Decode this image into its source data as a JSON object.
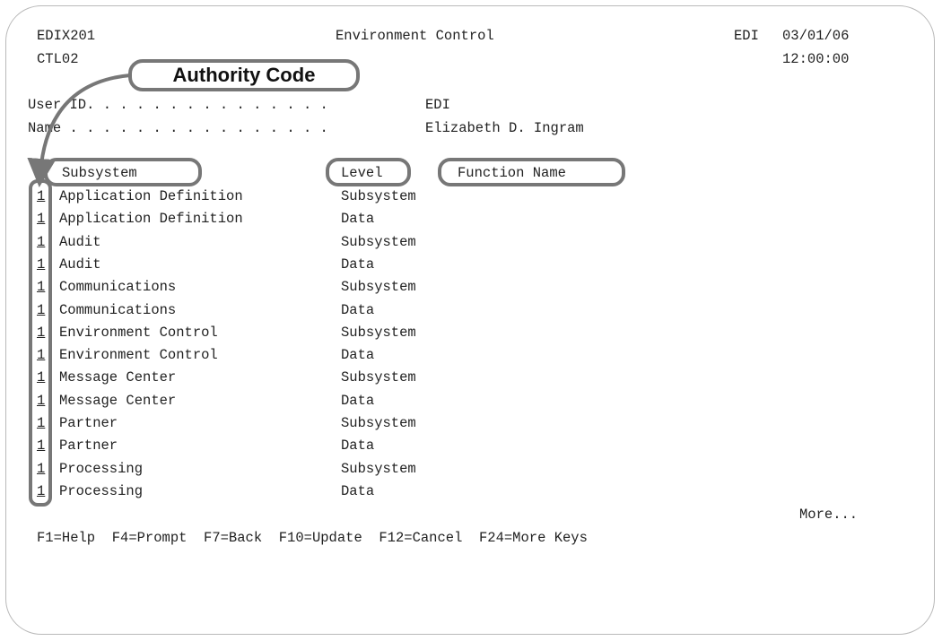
{
  "header": {
    "program_id": "EDIX201",
    "screen_id": "CTL02",
    "title": "Environment Control",
    "system": "EDI",
    "date": "03/01/06",
    "time": "12:00:00"
  },
  "fields": {
    "user_id_label": "User ID. . . . . . . . . . . . . . .",
    "user_id_value": "EDI",
    "name_label": "Name . . . . . . . . . . . . . . . .",
    "name_value": "Elizabeth D. Ingram"
  },
  "columns": {
    "subsystem": "Subsystem",
    "level": "Level",
    "function_name": "Function Name"
  },
  "rows": [
    {
      "code": "1",
      "subsystem": "Application Definition",
      "level": "Subsystem"
    },
    {
      "code": "1",
      "subsystem": "Application Definition",
      "level": "Data"
    },
    {
      "code": "1",
      "subsystem": "Audit",
      "level": "Subsystem"
    },
    {
      "code": "1",
      "subsystem": "Audit",
      "level": "Data"
    },
    {
      "code": "1",
      "subsystem": "Communications",
      "level": "Subsystem"
    },
    {
      "code": "1",
      "subsystem": "Communications",
      "level": "Data"
    },
    {
      "code": "1",
      "subsystem": "Environment Control",
      "level": "Subsystem"
    },
    {
      "code": "1",
      "subsystem": "Environment Control",
      "level": "Data"
    },
    {
      "code": "1",
      "subsystem": "Message Center",
      "level": "Subsystem"
    },
    {
      "code": "1",
      "subsystem": "Message Center",
      "level": "Data"
    },
    {
      "code": "1",
      "subsystem": "Partner",
      "level": "Subsystem"
    },
    {
      "code": "1",
      "subsystem": "Partner",
      "level": "Data"
    },
    {
      "code": "1",
      "subsystem": "Processing",
      "level": "Subsystem"
    },
    {
      "code": "1",
      "subsystem": "Processing",
      "level": "Data"
    }
  ],
  "more_indicator": "More...",
  "function_keys": "F1=Help  F4=Prompt  F7=Back  F10=Update  F12=Cancel  F24=More Keys",
  "callout": {
    "label": "Authority Code"
  }
}
